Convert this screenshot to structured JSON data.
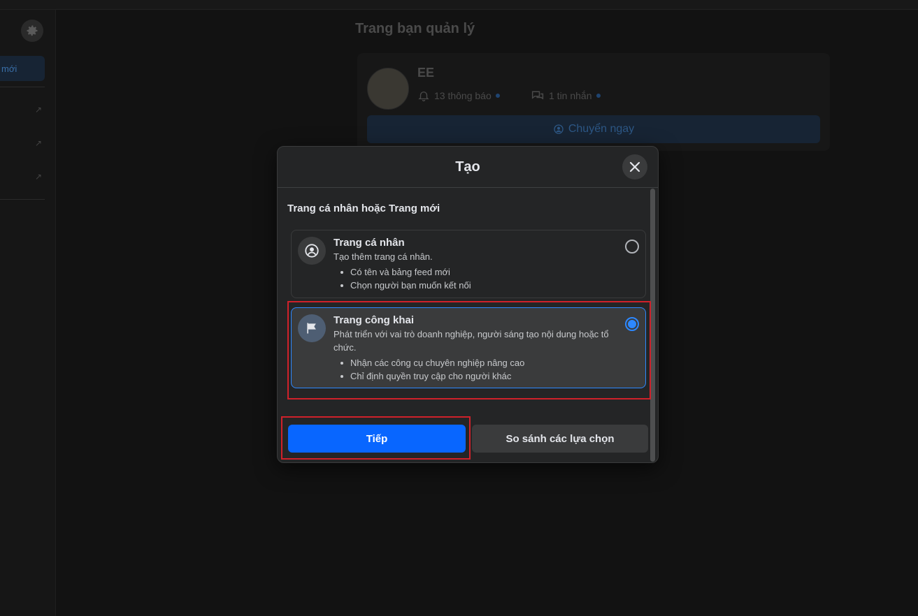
{
  "background": {
    "sidebar": {
      "new_label": "mới"
    },
    "title": "Trang bạn quản lý",
    "page_card": {
      "name": "EE",
      "notifications": "13 thông báo",
      "messages": "1 tin nhắn",
      "switch_label": "Chuyển ngay"
    }
  },
  "modal": {
    "title": "Tạo",
    "section_title": "Trang cá nhân hoặc Trang mới",
    "options": [
      {
        "title": "Trang cá nhân",
        "description": "Tạo thêm trang cá nhân.",
        "bullets": [
          "Có tên và bảng feed mới",
          "Chọn người bạn muốn kết nối"
        ],
        "selected": false,
        "icon": "person-circle-icon"
      },
      {
        "title": "Trang công khai",
        "description": "Phát triển với vai trò doanh nghiệp, người sáng tạo nội dung hoặc tổ chức.",
        "bullets": [
          "Nhận các công cụ chuyên nghiệp nâng cao",
          "Chỉ định quyền truy cập cho người khác"
        ],
        "selected": true,
        "icon": "flag-icon"
      }
    ],
    "buttons": {
      "next": "Tiếp",
      "compare": "So sánh các lựa chọn"
    }
  },
  "colors": {
    "accent": "#0866ff",
    "radio_selected": "#2d88ff",
    "highlight": "#d0212a"
  }
}
